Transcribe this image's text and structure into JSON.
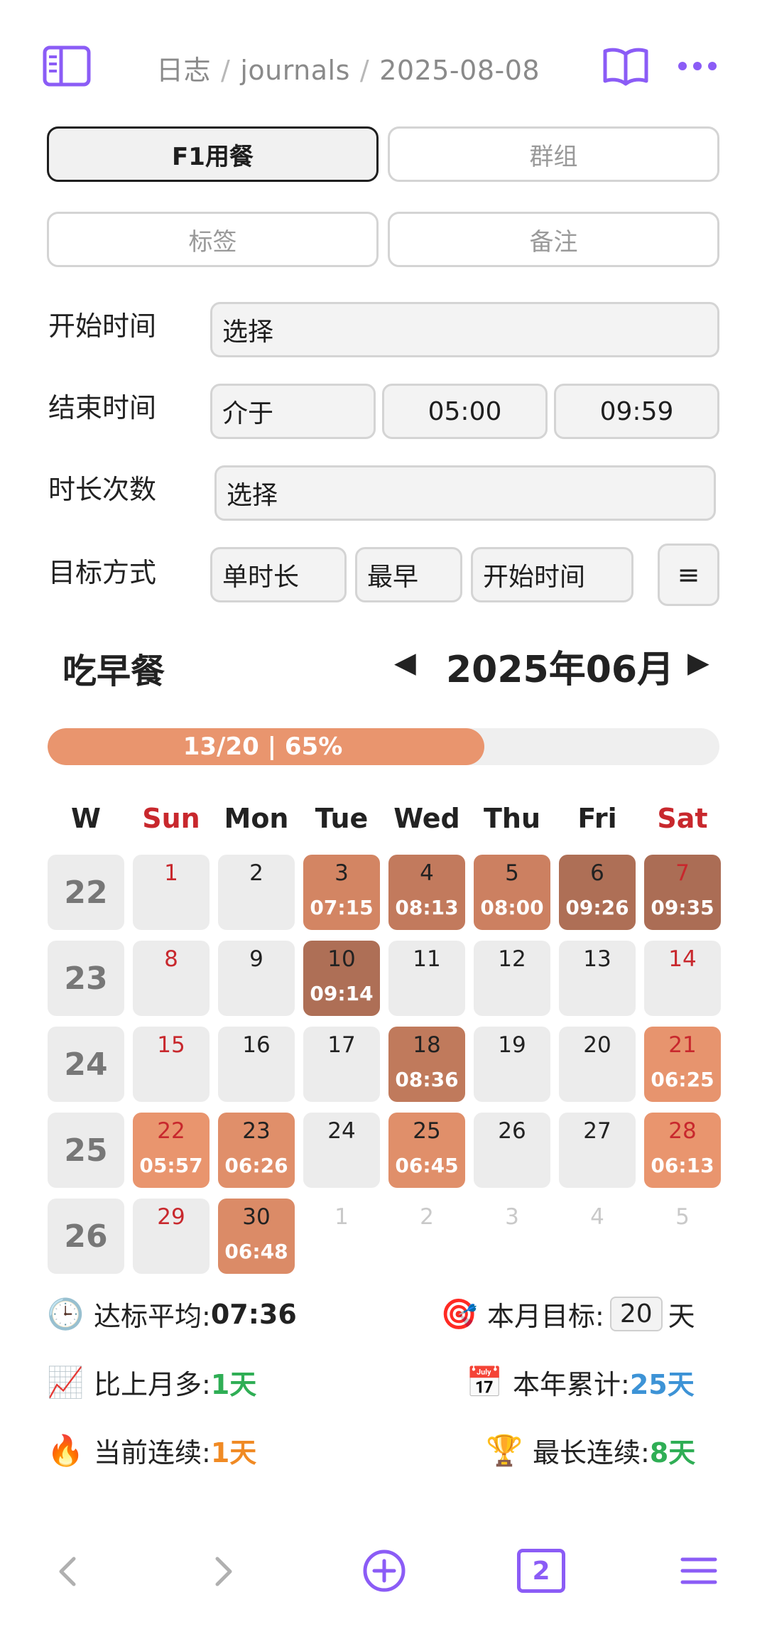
{
  "breadcrumb": {
    "root": "日志",
    "folder": "journals",
    "page": "2025-08-08"
  },
  "tabs": {
    "row1": [
      {
        "label": "F1用餐",
        "active": true
      },
      {
        "label": "群组",
        "active": false
      }
    ],
    "row2": [
      {
        "label": "标签",
        "active": false
      },
      {
        "label": "备注",
        "active": false
      }
    ]
  },
  "filters": {
    "start_time": {
      "label": "开始时间",
      "value": "选择"
    },
    "end_time": {
      "label": "结束时间",
      "mode": "介于",
      "from": "05:00",
      "to": "09:59"
    },
    "duration": {
      "label": "时长次数",
      "value": "选择"
    },
    "target": {
      "label": "目标方式",
      "type": "单时长",
      "pick": "最早",
      "field": "开始时间",
      "menu_icon": "≡"
    }
  },
  "calendar": {
    "title": "吃早餐",
    "month": "2025年06月",
    "prev_icon": "◀",
    "next_icon": "▶",
    "progress": {
      "text": "13/20 | 65%",
      "fraction": 0.65
    },
    "headers": [
      "W",
      "Sun",
      "Mon",
      "Tue",
      "Wed",
      "Thu",
      "Fri",
      "Sat"
    ],
    "weeks": [
      {
        "w": "22",
        "days": [
          {
            "d": "1",
            "t": "",
            "c": ""
          },
          {
            "d": "2",
            "t": "",
            "c": ""
          },
          {
            "d": "3",
            "t": "07:15",
            "c": "#d38563"
          },
          {
            "d": "4",
            "t": "08:13",
            "c": "#c27a5d"
          },
          {
            "d": "5",
            "t": "08:00",
            "c": "#cc8061"
          },
          {
            "d": "6",
            "t": "09:26",
            "c": "#ae6f56"
          },
          {
            "d": "7",
            "t": "09:35",
            "c": "#ab6d55"
          }
        ]
      },
      {
        "w": "23",
        "days": [
          {
            "d": "8",
            "t": "",
            "c": ""
          },
          {
            "d": "9",
            "t": "",
            "c": ""
          },
          {
            "d": "10",
            "t": "09:14",
            "c": "#ae6f56"
          },
          {
            "d": "11",
            "t": "",
            "c": ""
          },
          {
            "d": "12",
            "t": "",
            "c": ""
          },
          {
            "d": "13",
            "t": "",
            "c": ""
          },
          {
            "d": "14",
            "t": "",
            "c": ""
          }
        ]
      },
      {
        "w": "24",
        "days": [
          {
            "d": "15",
            "t": "",
            "c": ""
          },
          {
            "d": "16",
            "t": "",
            "c": ""
          },
          {
            "d": "17",
            "t": "",
            "c": ""
          },
          {
            "d": "18",
            "t": "08:36",
            "c": "#c07a5c"
          },
          {
            "d": "19",
            "t": "",
            "c": ""
          },
          {
            "d": "20",
            "t": "",
            "c": ""
          },
          {
            "d": "21",
            "t": "06:25",
            "c": "#e7946e"
          }
        ]
      },
      {
        "w": "25",
        "days": [
          {
            "d": "22",
            "t": "05:57",
            "c": "#e9956e"
          },
          {
            "d": "23",
            "t": "06:26",
            "c": "#e08f6a"
          },
          {
            "d": "24",
            "t": "",
            "c": ""
          },
          {
            "d": "25",
            "t": "06:45",
            "c": "#e08f6a"
          },
          {
            "d": "26",
            "t": "",
            "c": ""
          },
          {
            "d": "27",
            "t": "",
            "c": ""
          },
          {
            "d": "28",
            "t": "06:13",
            "c": "#e9956e"
          }
        ]
      },
      {
        "w": "26",
        "days": [
          {
            "d": "29",
            "t": "",
            "c": ""
          },
          {
            "d": "30",
            "t": "06:48",
            "c": "#db8b67"
          },
          {
            "d": "1",
            "t": "",
            "c": "blank"
          },
          {
            "d": "2",
            "t": "",
            "c": "blank"
          },
          {
            "d": "3",
            "t": "",
            "c": "blank"
          },
          {
            "d": "4",
            "t": "",
            "c": "blank"
          },
          {
            "d": "5",
            "t": "",
            "c": "blank"
          }
        ]
      }
    ]
  },
  "stats": {
    "avg": {
      "icon": "🕒",
      "label": "达标平均: ",
      "value": "07:36"
    },
    "goal": {
      "icon": "🎯",
      "label": "本月目标: ",
      "value": "20",
      "unit": "天"
    },
    "vs_last": {
      "icon": "📈",
      "label": "比上月多: ",
      "value": "1天",
      "color": "#2fae55"
    },
    "year_total": {
      "icon": "📅",
      "label": "本年累计: ",
      "value": "25天",
      "color": "#3d93d6"
    },
    "streak": {
      "icon": "🔥",
      "label": "当前连续: ",
      "value": "1天",
      "color": "#f08a24"
    },
    "best": {
      "icon": "🏆",
      "label": "最长连续: ",
      "value": "8天",
      "color": "#2fae55"
    }
  },
  "bottom_nav": {
    "tab_count": "2"
  },
  "colors": {
    "accent": "#8b5cf6",
    "sunday": "#c8282d",
    "saturday": "#c8282d"
  }
}
